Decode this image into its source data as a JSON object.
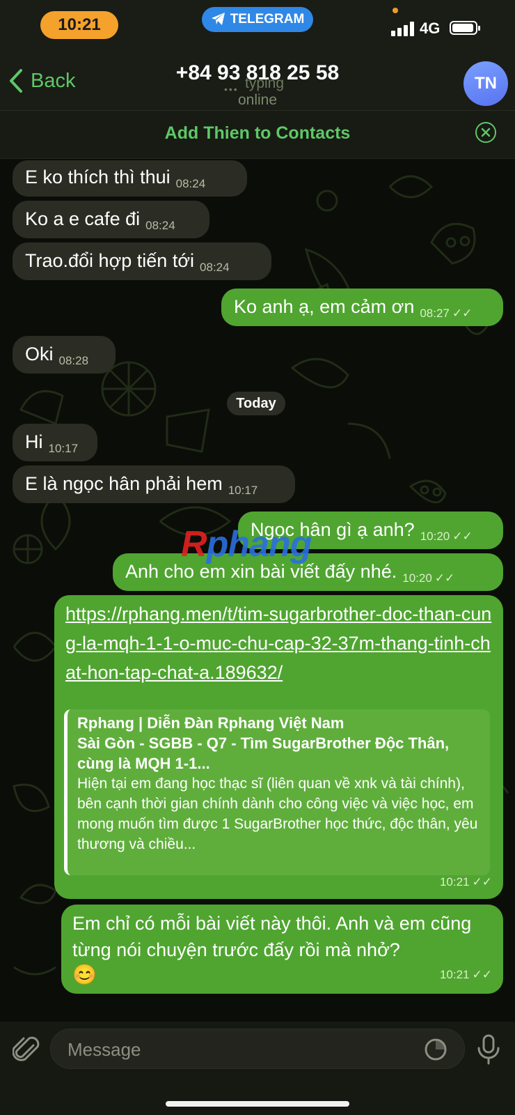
{
  "status_bar": {
    "time": "10:21",
    "app_badge": "TELEGRAM",
    "network": "4G"
  },
  "header": {
    "back_label": "Back",
    "title": "+84 93 818 25 58",
    "typing_dots": "•••",
    "typing_text": "typing",
    "status": "online",
    "avatar_initials": "TN"
  },
  "contacts_bar": {
    "label": "Add Thien to Contacts"
  },
  "messages": [
    {
      "text": "E ko thích thì thui",
      "time": "08:24"
    },
    {
      "text": "Ko a e cafe đi",
      "time": "08:24"
    },
    {
      "text": "Trao.đổi hợp tiến tới",
      "time": "08:24"
    },
    {
      "text": "Ko anh ạ, em cảm ơn",
      "time": "08:27"
    },
    {
      "text": "Oki",
      "time": "08:28"
    },
    {
      "text": "Hi",
      "time": "10:17"
    },
    {
      "text": "E là ngọc hân phải hem",
      "time": "10:17"
    },
    {
      "text": "Ngọc hân gì ạ anh?",
      "time": "10:20"
    },
    {
      "text": "Anh cho em xin bài viết đấy nhé.",
      "time": "10:20"
    },
    {
      "link": "https://rphang.men/t/tim-sugarbrother-doc-than-cung-la-mqh-1-1-o-muc-chu-cap-32-37m-thang-tinh-chat-hon-tap-chat-a.189632/",
      "preview_site": "Rphang | Diễn Đàn Rphang Việt Nam",
      "preview_title": "Sài Gòn - SGBB - Q7 - Tìm SugarBrother Độc Thân, cùng là MQH 1-1...",
      "preview_desc": "Hiện tại em đang học thạc sĩ (liên quan về xnk và tài chính), bên cạnh thời gian chính dành cho công việc và việc học, em mong muốn tìm được 1 SugarBrother học thức, độc thân, yêu thương và chiều...",
      "time": "10:21"
    },
    {
      "text": "Em chỉ có mỗi bài viết này thôi. Anh và em cũng từng nói chuyện trước đấy rồi mà nhở?",
      "emoji": "😊",
      "time": "10:21"
    }
  ],
  "day_separator": "Today",
  "watermark": {
    "r": "R",
    "rest": "phang"
  },
  "input": {
    "placeholder": "Message"
  },
  "colors": {
    "accent": "#5ec866",
    "outgoing_bubble": "#4fa530",
    "incoming_bubble": "#2b2d24",
    "time_pill": "#f4a22b",
    "telegram_pill": "#2f88e6"
  }
}
